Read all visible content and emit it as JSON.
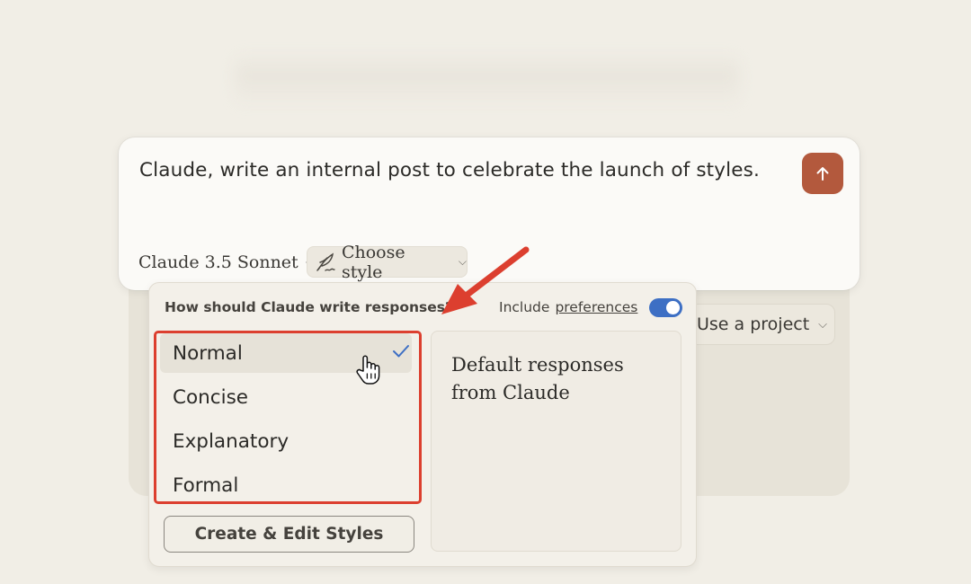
{
  "composer": {
    "prompt": "Claude, write an internal post to celebrate the launch of styles.",
    "model_label": "Claude 3.5 Sonnet",
    "style_label": "Choose style",
    "send_color": "#b3593d"
  },
  "background": {
    "use_project_label": "Use a project"
  },
  "style_menu": {
    "question": "How should Claude write responses?",
    "include_label": "Include",
    "preferences_link": "preferences",
    "include_preferences_enabled": true,
    "items": [
      {
        "label": "Normal",
        "selected": true
      },
      {
        "label": "Concise",
        "selected": false
      },
      {
        "label": "Explanatory",
        "selected": false
      },
      {
        "label": "Formal",
        "selected": false
      }
    ],
    "description": "Default responses from Claude",
    "create_button": "Create & Edit Styles"
  },
  "colors": {
    "highlight_red": "#dc3f2f",
    "toggle_blue": "#3d6fc4",
    "check_blue": "#3d6fc4"
  },
  "icons": [
    "arrow-up-icon",
    "chevron-down-icon",
    "pen-style-icon",
    "checkmark-icon",
    "hand-cursor-icon",
    "annotation-arrow"
  ]
}
